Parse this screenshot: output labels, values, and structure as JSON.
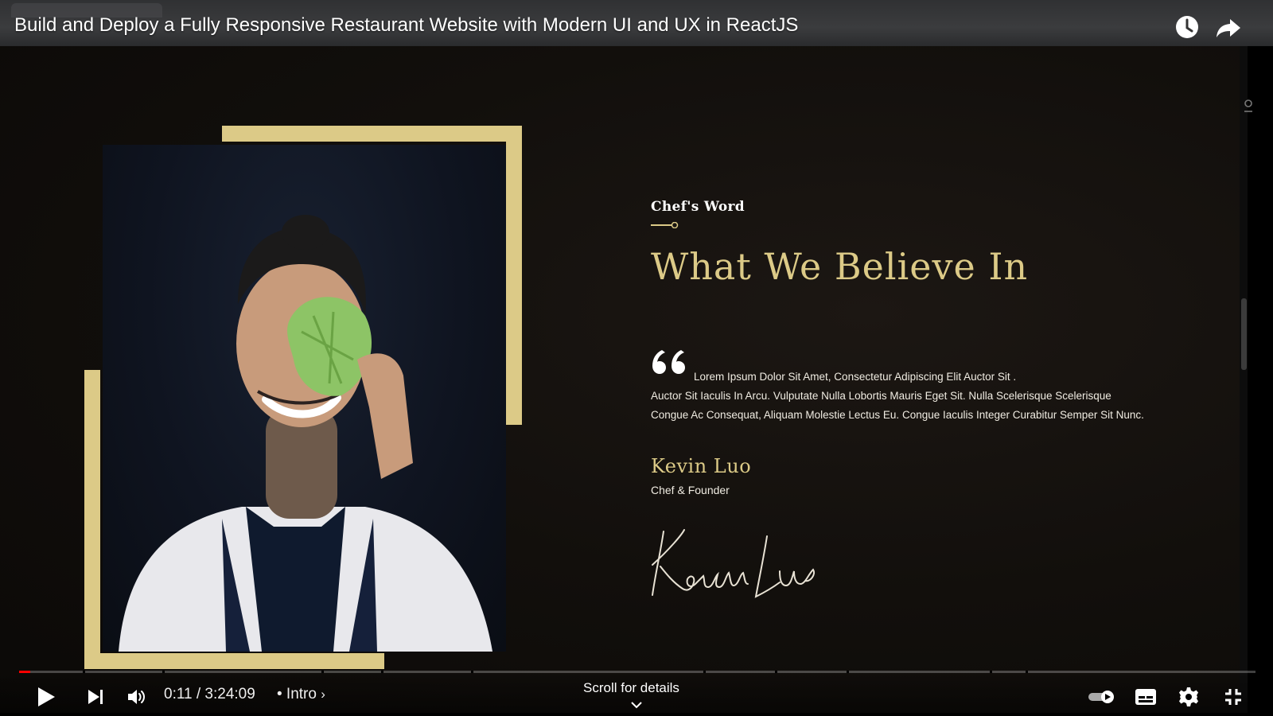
{
  "window": {
    "video_title": "Build and Deploy a Fully Responsive Restaurant Website with Modern UI and UX in ReactJS",
    "icons": [
      "watch-later-icon",
      "share-icon"
    ]
  },
  "page": {
    "subtitle": "Chef's Word",
    "headline": "What We Believe In",
    "quote_line1": "Lorem Ipsum Dolor Sit Amet, Consectetur Adipiscing Elit Auctor Sit .",
    "quote_line2": "Auctor Sit Iaculis In Arcu. Vulputate Nulla Lobortis Mauris Eget Sit. Nulla Scelerisque Scelerisque",
    "quote_line3": "Congue Ac Consequat, Aliquam Molestie Lectus Eu. Congue Iaculis Integer Curabitur Semper Sit Nunc.",
    "chef_name": "Kevin Luo",
    "chef_role": "Chef & Founder",
    "signature_text": "Kevin Luo",
    "accent_color": "#dcca87"
  },
  "player": {
    "current_time": "0:11",
    "duration": "3:24:09",
    "time_display": "0:11 / 3:24:09",
    "chapter_label": "• Intro",
    "scroll_hint": "Scroll for details",
    "progress_fraction": 0.0009,
    "progress_color": "#ff0000",
    "controls": [
      "play-icon",
      "next-icon",
      "volume-icon",
      "autoplay-toggle",
      "subtitles-icon",
      "settings-icon",
      "exit-fullscreen-icon"
    ]
  }
}
